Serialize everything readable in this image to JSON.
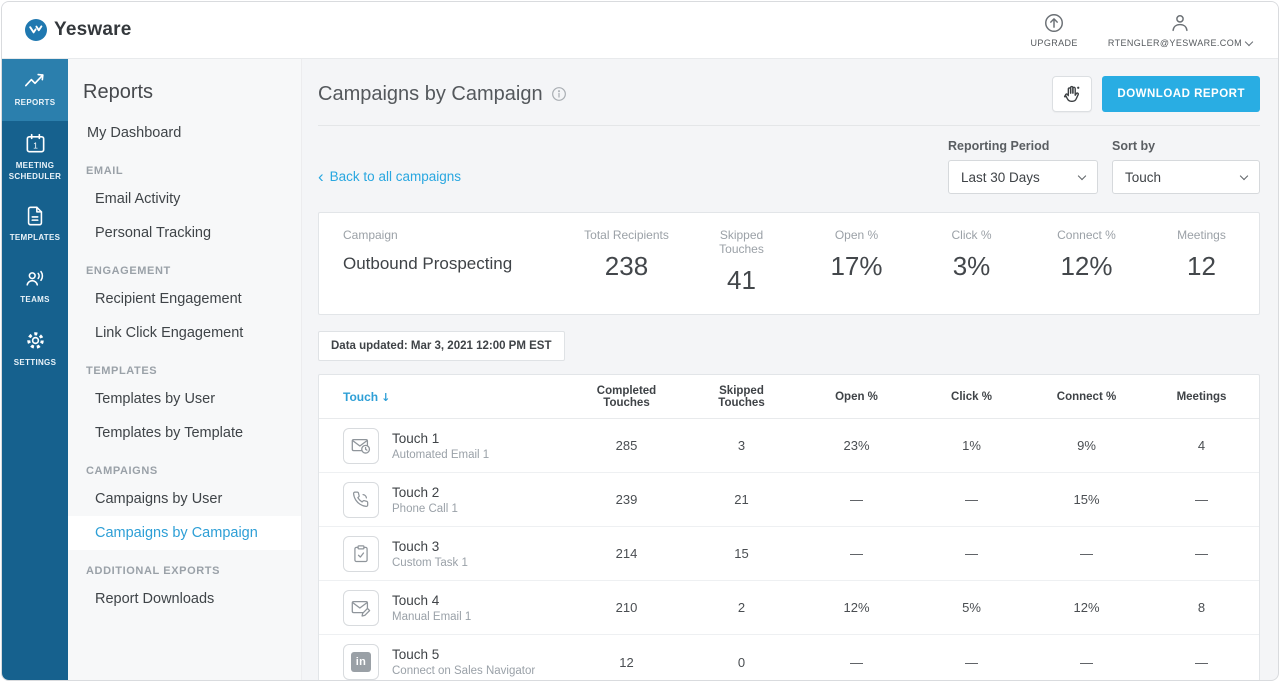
{
  "header": {
    "brand": "Yesware",
    "upgrade_label": "UPGRADE",
    "account_label": "RTENGLER@YESWARE.COM"
  },
  "rail": {
    "items": [
      {
        "label": "REPORTS",
        "selected": true
      },
      {
        "label": "MEETING SCHEDULER",
        "selected": false
      },
      {
        "label": "TEMPLATES",
        "selected": false
      },
      {
        "label": "TEAMS",
        "selected": false
      },
      {
        "label": "SETTINGS",
        "selected": false
      }
    ]
  },
  "sidebar": {
    "title": "Reports",
    "items": [
      {
        "type": "link",
        "label": "My Dashboard"
      },
      {
        "type": "section",
        "label": "EMAIL"
      },
      {
        "type": "link",
        "label": "Email Activity"
      },
      {
        "type": "link",
        "label": "Personal Tracking"
      },
      {
        "type": "section",
        "label": "ENGAGEMENT"
      },
      {
        "type": "link",
        "label": "Recipient Engagement"
      },
      {
        "type": "link",
        "label": "Link Click Engagement"
      },
      {
        "type": "section",
        "label": "TEMPLATES"
      },
      {
        "type": "link",
        "label": "Templates by User"
      },
      {
        "type": "link",
        "label": "Templates by Template"
      },
      {
        "type": "section",
        "label": "CAMPAIGNS"
      },
      {
        "type": "link",
        "label": "Campaigns by User"
      },
      {
        "type": "link",
        "label": "Campaigns by Campaign",
        "selected": true
      },
      {
        "type": "section",
        "label": "ADDITIONAL EXPORTS"
      },
      {
        "type": "link",
        "label": "Report Downloads"
      }
    ]
  },
  "main": {
    "title": "Campaigns by Campaign",
    "download_button": "DOWNLOAD REPORT",
    "back_link": "Back to all campaigns",
    "back_caret": "‹",
    "filters": {
      "reporting_period": {
        "label": "Reporting Period",
        "value": "Last 30 Days"
      },
      "sort_by": {
        "label": "Sort by",
        "value": "Touch"
      }
    },
    "summary": {
      "campaign_label": "Campaign",
      "campaign_name": "Outbound Prospecting",
      "metrics": [
        {
          "label": "Total Recipients",
          "value": "238"
        },
        {
          "label": "Skipped Touches",
          "value": "41"
        },
        {
          "label": "Open %",
          "value": "17%"
        },
        {
          "label": "Click %",
          "value": "3%"
        },
        {
          "label": "Connect %",
          "value": "12%"
        },
        {
          "label": "Meetings",
          "value": "12"
        }
      ]
    },
    "data_updated": "Data updated: Mar 3, 2021 12:00 PM EST",
    "table": {
      "sort_arrow": "↓",
      "headers": [
        "Touch",
        "Completed Touches",
        "Skipped Touches",
        "Open %",
        "Click %",
        "Connect %",
        "Meetings"
      ],
      "linkedin_badge": "in",
      "rows": [
        {
          "touch": "Touch 1",
          "subtitle": "Automated Email 1",
          "icon": "automated-email-icon",
          "completed": "285",
          "skipped": "3",
          "open": "23%",
          "click": "1%",
          "connect": "9%",
          "meetings": "4"
        },
        {
          "touch": "Touch 2",
          "subtitle": "Phone Call 1",
          "icon": "phone-call-icon",
          "completed": "239",
          "skipped": "21",
          "open": "—",
          "click": "—",
          "connect": "15%",
          "meetings": "—"
        },
        {
          "touch": "Touch 3",
          "subtitle": "Custom Task 1",
          "icon": "custom-task-icon",
          "completed": "214",
          "skipped": "15",
          "open": "—",
          "click": "—",
          "connect": "—",
          "meetings": "—"
        },
        {
          "touch": "Touch 4",
          "subtitle": "Manual Email 1",
          "icon": "manual-email-icon",
          "completed": "210",
          "skipped": "2",
          "open": "12%",
          "click": "5%",
          "connect": "12%",
          "meetings": "8"
        },
        {
          "touch": "Touch 5",
          "subtitle": "Connect on Sales Navigator",
          "icon": "linkedin-icon",
          "completed": "12",
          "skipped": "0",
          "open": "—",
          "click": "—",
          "connect": "—",
          "meetings": "—"
        }
      ]
    }
  },
  "colors": {
    "rail_bg": "#16618E",
    "rail_selected_bg": "#2B7FAD",
    "accent_blue": "#29A7E0",
    "download_button_bg": "#29ADE3",
    "selected_nav_text": "#2E9FD6"
  }
}
